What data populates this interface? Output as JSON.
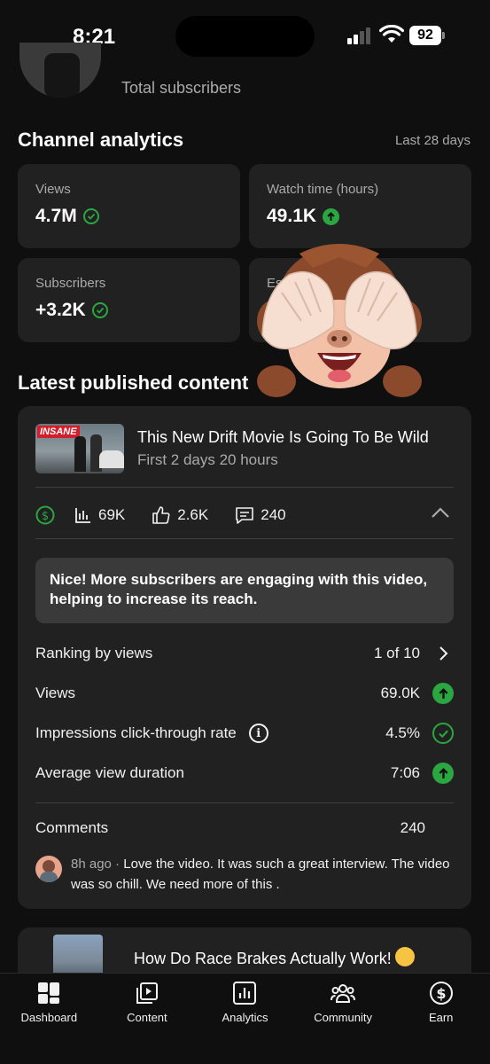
{
  "status": {
    "time": "8:21",
    "battery": "92"
  },
  "header": {
    "total_subscribers_label": "Total subscribers"
  },
  "analytics": {
    "title": "Channel analytics",
    "period": "Last 28 days",
    "cards": [
      {
        "label": "Views",
        "value": "4.7M",
        "status": "check"
      },
      {
        "label": "Watch time (hours)",
        "value": "49.1K",
        "status": "up"
      },
      {
        "label": "Subscribers",
        "value": "+3.2K",
        "status": "check"
      },
      {
        "label": "Esti",
        "value": ""
      }
    ]
  },
  "latest": {
    "title": "Latest published content",
    "video": {
      "thumb_tag": "INSANE",
      "title": "This New Drift Movie Is Going To Be Wild",
      "subtitle": "First 2 days 20 hours",
      "views": "69K",
      "likes": "2.6K",
      "comments": "240"
    },
    "insight": "Nice! More subscribers are engaging with this video, helping to increase its reach.",
    "rows": [
      {
        "label": "Ranking by views",
        "value": "1 of 10",
        "indicator": "chevron-right"
      },
      {
        "label": "Views",
        "value": "69.0K",
        "indicator": "up"
      },
      {
        "label": "Impressions click-through rate",
        "value": "4.5%",
        "indicator": "check"
      },
      {
        "label": "Average view duration",
        "value": "7:06",
        "indicator": "up"
      }
    ],
    "comments_label": "Comments",
    "comments_count": "240",
    "comment": {
      "time": "8h ago",
      "separator": " · ",
      "text": "Love the video. It was such a great interview. The video was so chill. We need more of this ."
    }
  },
  "next_video": {
    "title": "How Do Race Brakes Actually Work!"
  },
  "nav": [
    "Dashboard",
    "Content",
    "Analytics",
    "Community",
    "Earn"
  ],
  "colors": {
    "background": "#0f0f0f",
    "card": "#212121",
    "green": "#2ba640"
  }
}
